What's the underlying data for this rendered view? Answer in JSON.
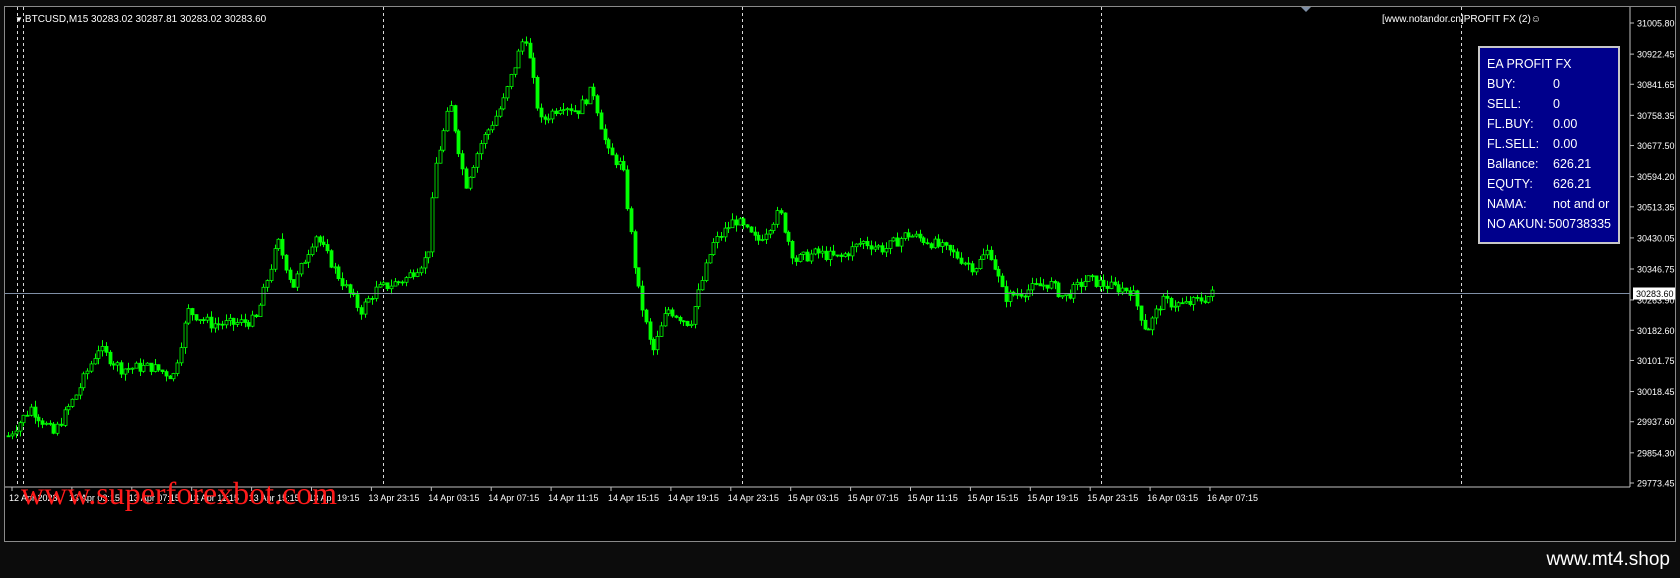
{
  "chart_header": {
    "symbol_line": "BTCUSD,M15  30283.02 30287.81 30283.02 30283.60",
    "ea_title": "[www.notandor.cn]PROFIT FX  (2)☺"
  },
  "ea_panel": {
    "title": "EA PROFIT FX",
    "rows": [
      {
        "label": "BUY:",
        "value": "0"
      },
      {
        "label": "SELL:",
        "value": "0"
      },
      {
        "label": "FL.BUY:",
        "value": "0.00"
      },
      {
        "label": "FL.SELL:",
        "value": "0.00"
      },
      {
        "label": "Ballance:",
        "value": "626.21"
      },
      {
        "label": "EQUTY:",
        "value": "626.21"
      },
      {
        "label": "NAMA:",
        "value": "not and or"
      },
      {
        "label": "NO AKUN:",
        "value": "500738335"
      }
    ]
  },
  "watermark": "www.superforexbot.com",
  "footer_brand": "www.mt4.shop",
  "colors": {
    "background": "#000000",
    "candle": "#00ff00",
    "price_line": "#7f8fa6",
    "grid": "#ffffff",
    "panel_bg": "#00008c",
    "watermark": "#ff1a1a",
    "axis_text": "#ffffff"
  },
  "chart_data": {
    "type": "candlestick",
    "symbol": "BTCUSD",
    "timeframe": "M15",
    "ohlc_last": {
      "open": 30283.02,
      "high": 30287.81,
      "low": 30283.02,
      "close": 30283.6
    },
    "current_price": 30283.6,
    "current_price_label": "30283.60",
    "y_ticks": [
      {
        "value": 31005.8,
        "label": "31005.80"
      },
      {
        "value": 30922.45,
        "label": "30922.45"
      },
      {
        "value": 30841.65,
        "label": "30841.65"
      },
      {
        "value": 30758.35,
        "label": "30758.35"
      },
      {
        "value": 30677.5,
        "label": "30677.50"
      },
      {
        "value": 30594.2,
        "label": "30594.20"
      },
      {
        "value": 30513.35,
        "label": "30513.35"
      },
      {
        "value": 30430.05,
        "label": "30430.05"
      },
      {
        "value": 30346.75,
        "label": "30346.75"
      },
      {
        "value": 30263.9,
        "label": "30263.90"
      },
      {
        "value": 30182.6,
        "label": "30182.60"
      },
      {
        "value": 30101.75,
        "label": "30101.75"
      },
      {
        "value": 30018.45,
        "label": "30018.45"
      },
      {
        "value": 29937.6,
        "label": "29937.60"
      },
      {
        "value": 29854.3,
        "label": "29854.30"
      },
      {
        "value": 29773.45,
        "label": "29773.45"
      }
    ],
    "x_ticks": [
      "12 Apr 2023",
      "13 Apr 03:15",
      "13 Apr 07:15",
      "13 Apr 11:15",
      "13 Apr 15:15",
      "13 Apr 19:15",
      "13 Apr 23:15",
      "14 Apr 03:15",
      "14 Apr 07:15",
      "14 Apr 11:15",
      "14 Apr 15:15",
      "14 Apr 19:15",
      "14 Apr 23:15",
      "15 Apr 03:15",
      "15 Apr 07:15",
      "15 Apr 11:15",
      "15 Apr 15:15",
      "15 Apr 19:15",
      "15 Apr 23:15",
      "16 Apr 03:15",
      "16 Apr 07:15"
    ],
    "day_separators": [
      "13 Apr 00:00",
      "14 Apr 00:00",
      "15 Apr 00:00",
      "16 Apr 00:00",
      "17 Apr 00:00"
    ],
    "close_path": [
      [
        "12 Apr 23:00",
        29900
      ],
      [
        "13 Apr 00:30",
        29975
      ],
      [
        "13 Apr 02:00",
        29905
      ],
      [
        "13 Apr 03:30",
        30010
      ],
      [
        "13 Apr 05:00",
        30135
      ],
      [
        "13 Apr 06:30",
        30080
      ],
      [
        "13 Apr 08:30",
        30085
      ],
      [
        "13 Apr 10:00",
        30060
      ],
      [
        "13 Apr 11:00",
        30235
      ],
      [
        "13 Apr 12:30",
        30200
      ],
      [
        "13 Apr 14:00",
        30200
      ],
      [
        "13 Apr 15:30",
        30210
      ],
      [
        "13 Apr 17:00",
        30420
      ],
      [
        "13 Apr 18:00",
        30300
      ],
      [
        "13 Apr 19:30",
        30440
      ],
      [
        "13 Apr 21:00",
        30330
      ],
      [
        "13 Apr 22:30",
        30235
      ],
      [
        "13 Apr 23:30",
        30290
      ],
      [
        "14 Apr 01:30",
        30320
      ],
      [
        "14 Apr 03:00",
        30380
      ],
      [
        "14 Apr 03:30",
        30620
      ],
      [
        "14 Apr 04:30",
        30790
      ],
      [
        "14 Apr 05:30",
        30570
      ],
      [
        "14 Apr 06:30",
        30680
      ],
      [
        "14 Apr 08:00",
        30790
      ],
      [
        "14 Apr 09:30",
        30980
      ],
      [
        "14 Apr 10:30",
        30740
      ],
      [
        "14 Apr 12:00",
        30790
      ],
      [
        "14 Apr 13:00",
        30770
      ],
      [
        "14 Apr 14:00",
        30830
      ],
      [
        "14 Apr 15:00",
        30660
      ],
      [
        "14 Apr 16:00",
        30620
      ],
      [
        "14 Apr 17:00",
        30300
      ],
      [
        "14 Apr 18:00",
        30120
      ],
      [
        "14 Apr 19:00",
        30240
      ],
      [
        "14 Apr 20:30",
        30200
      ],
      [
        "14 Apr 22:00",
        30410
      ],
      [
        "14 Apr 23:30",
        30480
      ],
      [
        "15 Apr 01:00",
        30420
      ],
      [
        "15 Apr 02:30",
        30500
      ],
      [
        "15 Apr 03:30",
        30370
      ],
      [
        "15 Apr 05:00",
        30390
      ],
      [
        "15 Apr 06:30",
        30375
      ],
      [
        "15 Apr 08:00",
        30420
      ],
      [
        "15 Apr 09:30",
        30400
      ],
      [
        "15 Apr 11:00",
        30440
      ],
      [
        "15 Apr 12:30",
        30420
      ],
      [
        "15 Apr 14:00",
        30390
      ],
      [
        "15 Apr 15:30",
        30350
      ],
      [
        "15 Apr 16:30",
        30400
      ],
      [
        "15 Apr 17:30",
        30270
      ],
      [
        "15 Apr 19:00",
        30290
      ],
      [
        "15 Apr 20:30",
        30310
      ],
      [
        "15 Apr 21:30",
        30270
      ],
      [
        "15 Apr 23:00",
        30320
      ],
      [
        "16 Apr 00:30",
        30300
      ],
      [
        "16 Apr 02:00",
        30290
      ],
      [
        "16 Apr 03:00",
        30180
      ],
      [
        "16 Apr 04:00",
        30260
      ],
      [
        "16 Apr 05:30",
        30250
      ],
      [
        "16 Apr 07:00",
        30270
      ],
      [
        "16 Apr 07:30",
        30283.6
      ]
    ]
  }
}
